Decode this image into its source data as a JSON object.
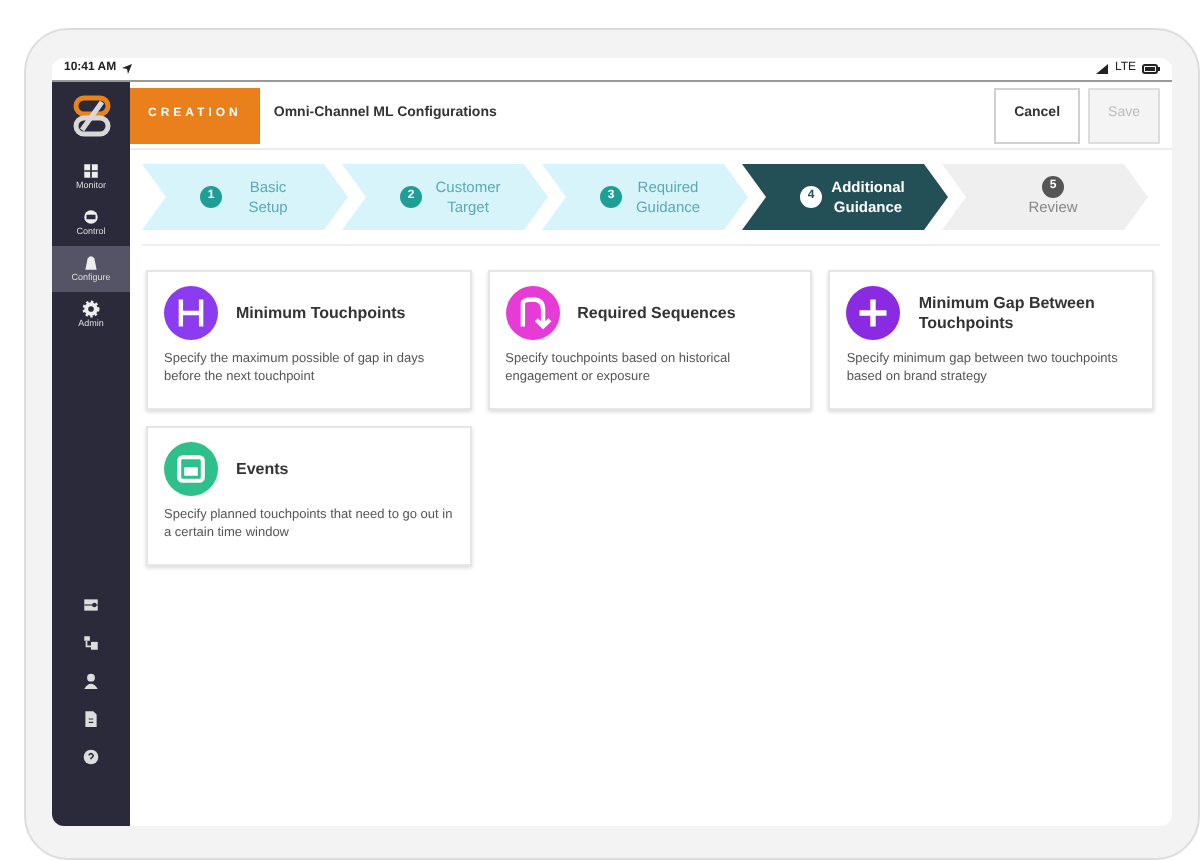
{
  "status_bar": {
    "time": "10:41 AM",
    "carrier": "LTE"
  },
  "sidebar": {
    "items": [
      {
        "label": "Monitor",
        "selected": false
      },
      {
        "label": "Control",
        "selected": false
      },
      {
        "label": "Configure",
        "selected": true
      },
      {
        "label": "Admin",
        "selected": false
      }
    ]
  },
  "header": {
    "badge": "CREATION",
    "title": "Omni-Channel ML Configurations",
    "buttons": [
      {
        "label": "Cancel",
        "disabled": false
      },
      {
        "label": "Save",
        "disabled": true
      }
    ]
  },
  "steps": [
    {
      "number": "1",
      "label": "Basic Setup",
      "completed": true,
      "selected": false
    },
    {
      "number": "2",
      "label": "Customer Target",
      "completed": true,
      "selected": false
    },
    {
      "number": "3",
      "label": "Required Guidance",
      "completed": true,
      "selected": false
    },
    {
      "number": "4",
      "label": "Additional Guidance",
      "completed": false,
      "selected": true
    },
    {
      "number": "5",
      "label": "Review",
      "completed": false,
      "selected": false
    }
  ],
  "cards": [
    {
      "title": "Minimum Touchpoints",
      "description": "Specify the maximum possible of gap in days before the next touchpoint",
      "color": "#8b3cf0"
    },
    {
      "title": "Required Sequences",
      "description": "Specify touchpoints based on historical engagement or exposure",
      "color": "#e63bd6"
    },
    {
      "title": "Minimum Gap Between Touchpoints",
      "description": "Specify minimum gap between two touchpoints based on brand strategy",
      "color": "#8a2be2"
    },
    {
      "title": "Events",
      "description": "Specify planned touchpoints that need to go out in a certain time window",
      "color": "#2ec08a"
    }
  ]
}
